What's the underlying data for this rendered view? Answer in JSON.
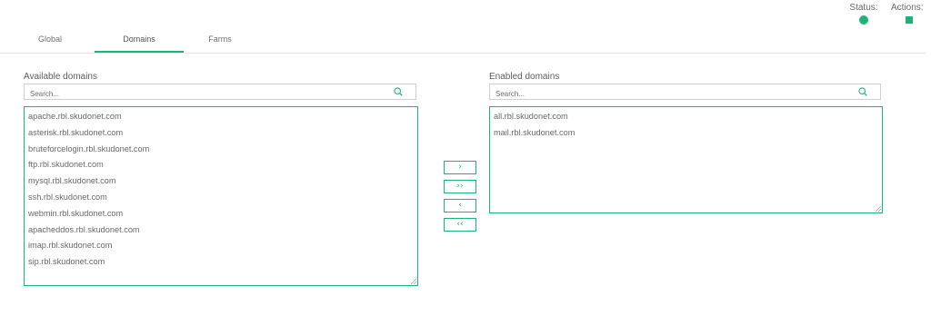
{
  "header": {
    "status_label": "Status:",
    "actions_label": "Actions:",
    "status_color": "#1ab47a"
  },
  "tabs": [
    {
      "label": "Global",
      "active": false
    },
    {
      "label": "Domains",
      "active": true
    },
    {
      "label": "Farms",
      "active": false
    }
  ],
  "available": {
    "title": "Available domains",
    "search_placeholder": "Search...",
    "items": [
      "apache.rbl.skudonet.com",
      "asterisk.rbl.skudonet.com",
      "bruteforcelogin.rbl.skudonet.com",
      "ftp.rbl.skudonet.com",
      "mysql.rbl.skudonet.com",
      "ssh.rbl.skudonet.com",
      "webmin.rbl.skudonet.com",
      "apacheddos.rbl.skudonet.com",
      "imap.rbl.skudonet.com",
      "sip.rbl.skudonet.com"
    ]
  },
  "enabled": {
    "title": "Enabled domains",
    "search_placeholder": "Search...",
    "items": [
      "all.rbl.skudonet.com",
      "mail.rbl.skudonet.com"
    ]
  },
  "move_buttons": {
    "move_right": "›",
    "move_all_right": "››",
    "move_left": "‹",
    "move_all_left": "‹‹"
  },
  "accent_color": "#1ab47a"
}
